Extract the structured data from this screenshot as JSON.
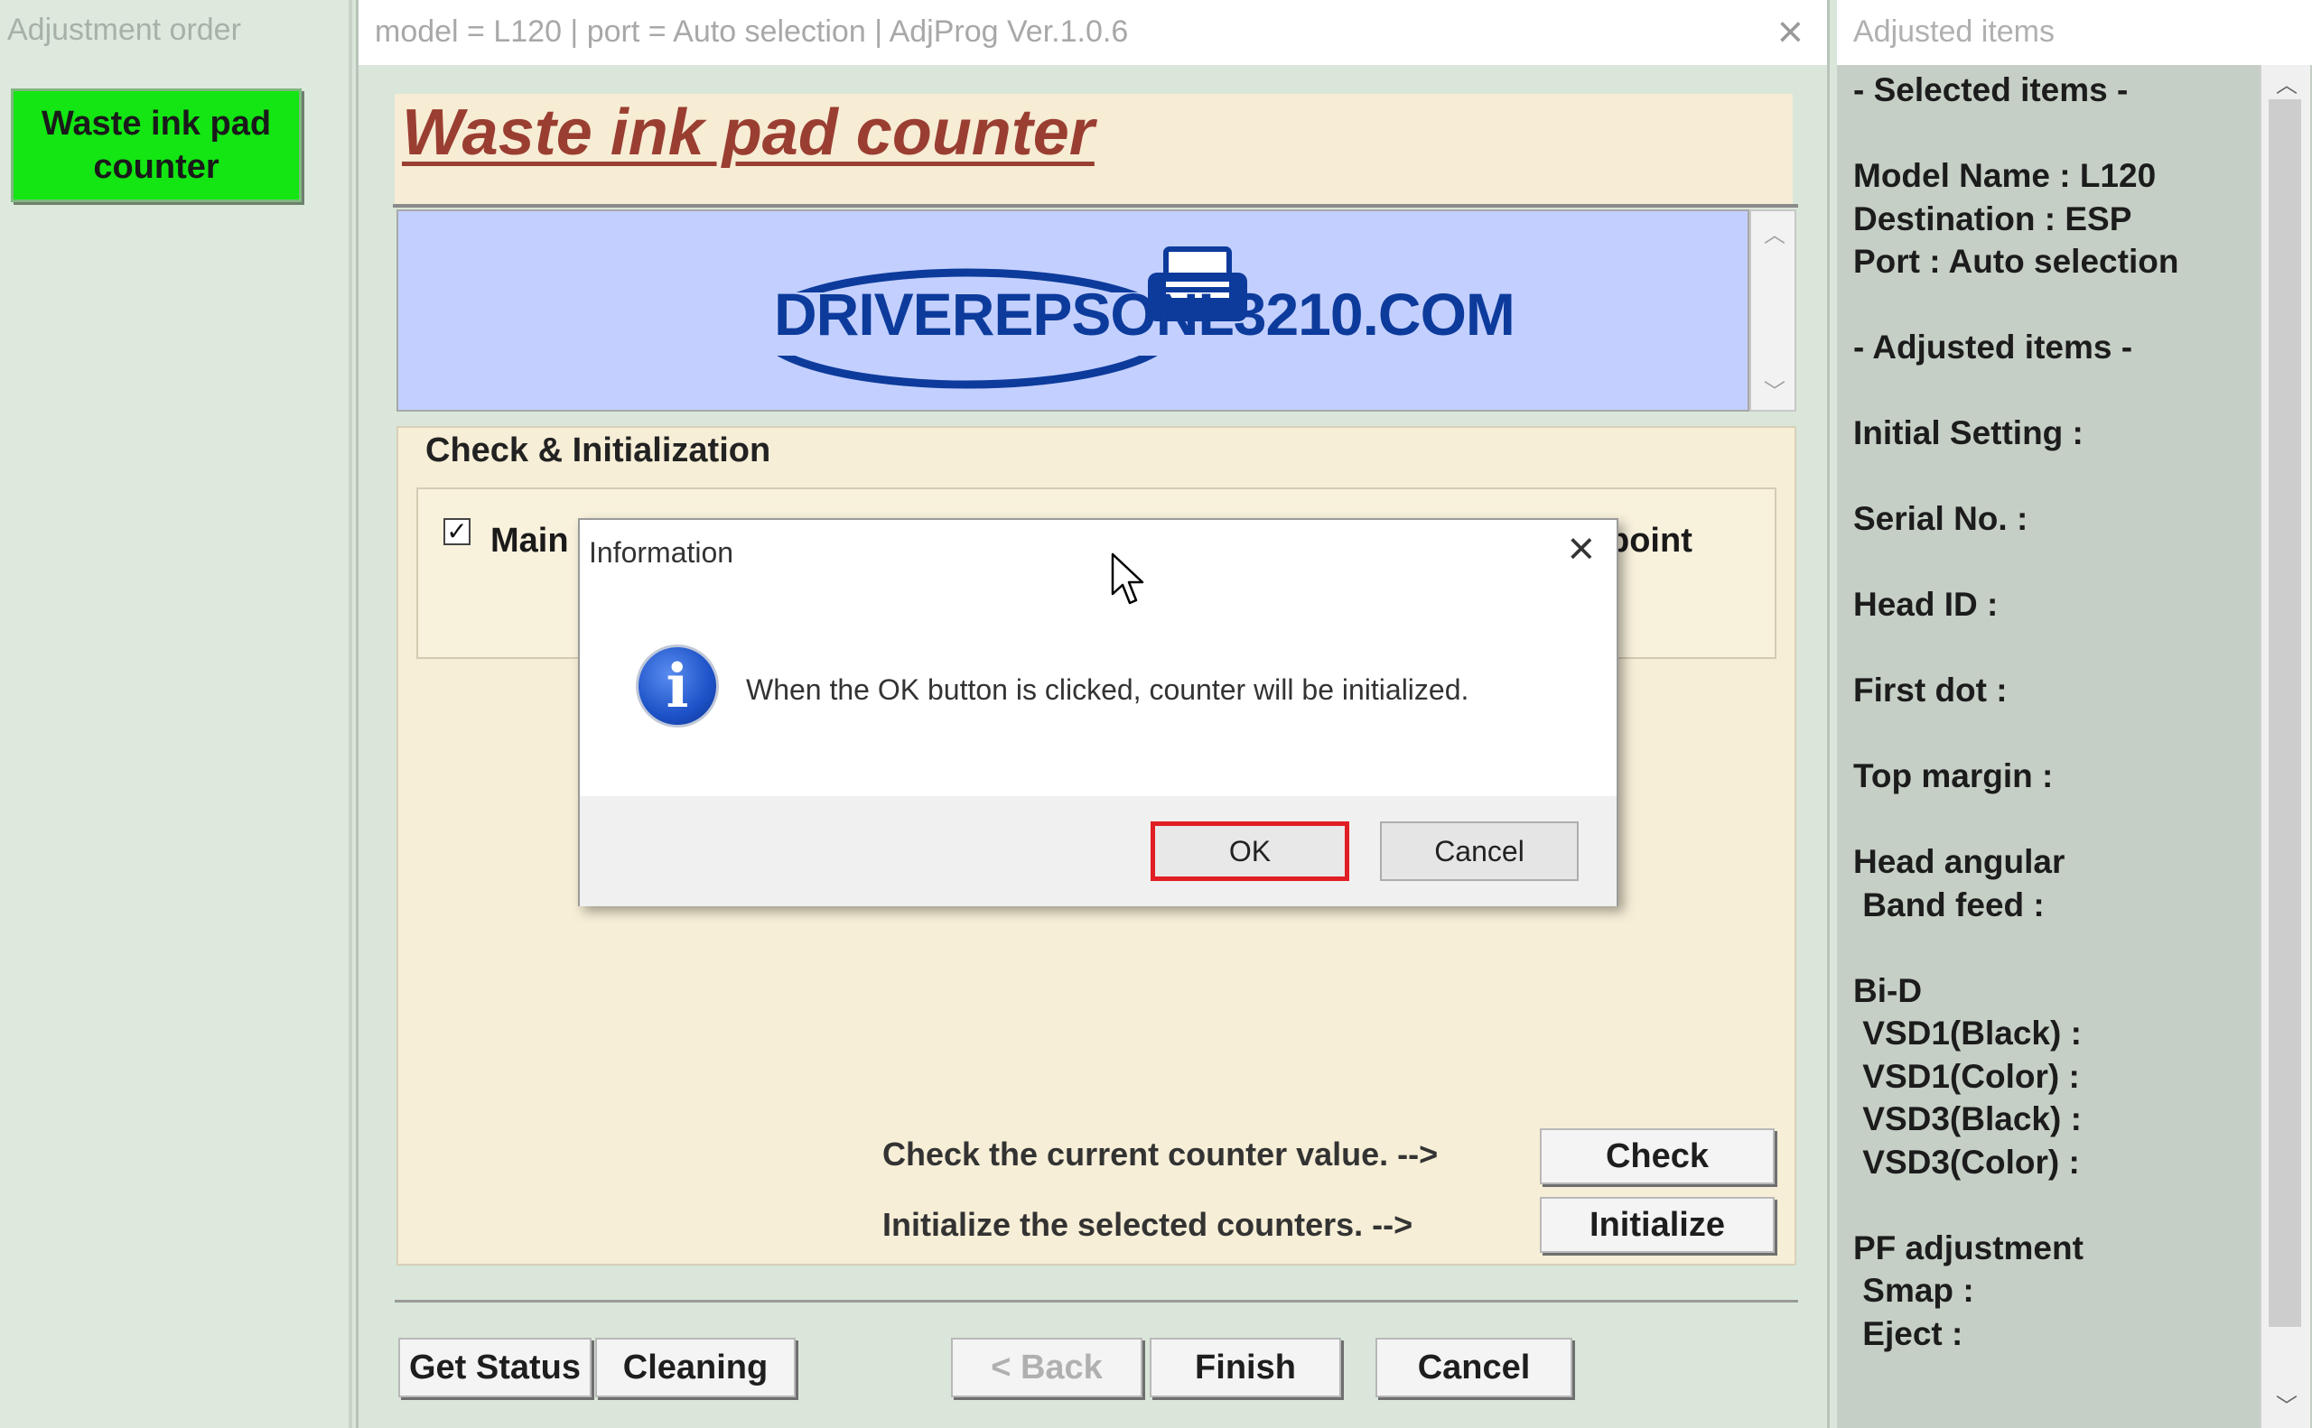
{
  "left_panel": {
    "title": "Adjustment order",
    "active_item": "Waste ink pad counter"
  },
  "main_window": {
    "title": "model = L120 | port = Auto selection | AdjProg Ver.1.0.6",
    "header": "Waste ink pad counter",
    "banner_logo": "DRIVEREPSONL3210.COM",
    "group_label": "Check & Initialization",
    "main_checkbox_label": "Main",
    "point_label": "point",
    "check_instruction": "Check the current counter value. -->",
    "initialize_instruction": "Initialize the selected counters. -->",
    "check_button": "Check",
    "initialize_button": "Initialize",
    "footer": {
      "get_status": "Get Status",
      "cleaning": "Cleaning",
      "back": "< Back",
      "finish": "Finish",
      "cancel": "Cancel"
    }
  },
  "right_panel": {
    "title": "Adjusted items",
    "content": "- Selected items -\n\nModel Name : L120\nDestination : ESP\nPort : Auto selection\n\n- Adjusted items -\n\nInitial Setting :\n\nSerial No. :\n\nHead ID :\n\nFirst dot :\n\nTop margin :\n\nHead angular\n Band feed :\n\nBi-D\n VSD1(Black) :\n VSD1(Color) :\n VSD3(Black) :\n VSD3(Color) :\n\nPF adjustment\n Smap :\n Eject :"
  },
  "dialog": {
    "title": "Information",
    "message": "When the OK button is clicked, counter will be initialized.",
    "ok": "OK",
    "cancel": "Cancel"
  },
  "colors": {
    "highlight_button": "#13e613",
    "header_title": "#9a3e32",
    "banner_bg": "#c3d0ff",
    "logo_blue": "#0d3b9c",
    "ok_highlight_border": "#e01e24"
  }
}
